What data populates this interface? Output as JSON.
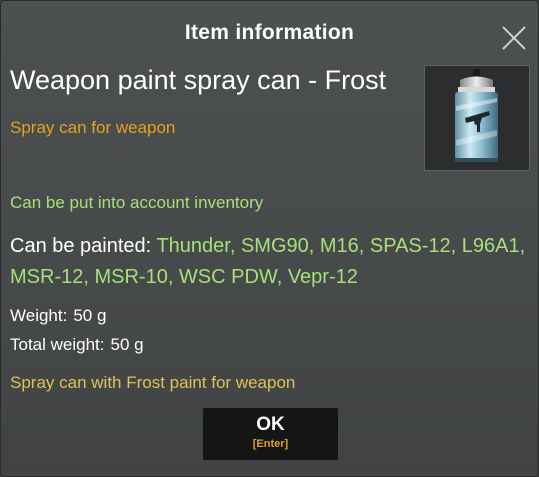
{
  "dialog": {
    "title": "Item information",
    "close_icon": "close-icon"
  },
  "item": {
    "name": "Weapon paint spray can - Frost",
    "type": "Spray can for weapon",
    "image_icon": "spray-can-frost-icon",
    "account_note": "Can be put into account inventory",
    "painted_label": "Can be painted:",
    "painted_list": "Thunder, SMG90, M16, SPAS-12, L96A1, MSR-12, MSR-10, WSC PDW, Vepr-12",
    "weight_label": "Weight:",
    "weight_value": "50 g",
    "total_weight_label": "Total weight:",
    "total_weight_value": "50 g",
    "description": "Spray can with Frost paint for weapon"
  },
  "ok_button": {
    "label": "OK",
    "hotkey": "[Enter]"
  },
  "colors": {
    "accent_orange": "#e3a21f",
    "accent_green": "#a5e07a",
    "description_yellow": "#e0c05a",
    "panel": "#474a4a"
  }
}
